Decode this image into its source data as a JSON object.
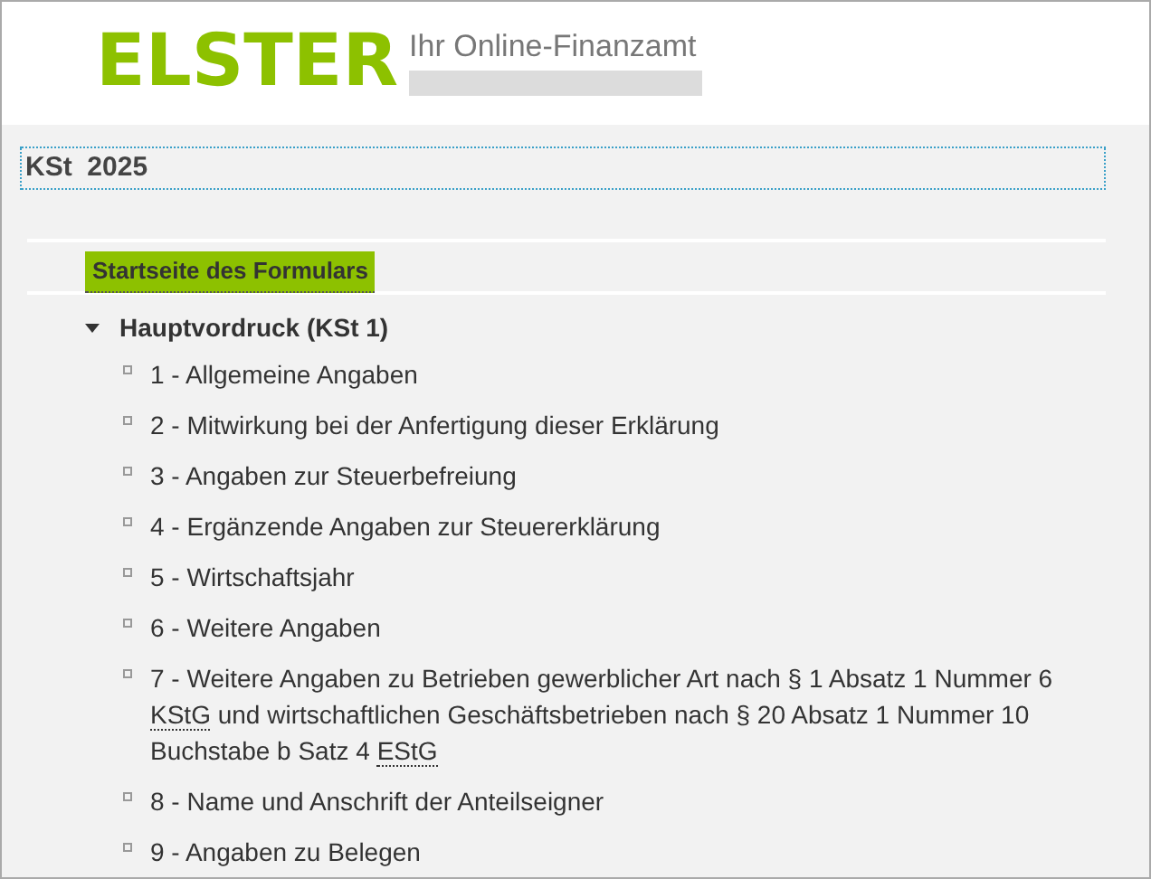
{
  "header": {
    "logo": "ELSTER",
    "subtitle": "Ihr Online-Finanzamt"
  },
  "form_title": "KSt  2025",
  "start_link": {
    "label": "Startseite des Formulars",
    "selected": true
  },
  "tree": {
    "label": "Hauptvordruck (KSt 1)",
    "expanded": true,
    "children": [
      {
        "segments": [
          {
            "kind": "plain",
            "text": "1 - Allgemeine Angaben"
          }
        ]
      },
      {
        "segments": [
          {
            "kind": "plain",
            "text": "2 - Mitwirkung bei der Anfertigung dieser Erklärung"
          }
        ]
      },
      {
        "segments": [
          {
            "kind": "plain",
            "text": "3 - Angaben zur Steuerbefreiung"
          }
        ]
      },
      {
        "segments": [
          {
            "kind": "plain",
            "text": "4 - Ergänzende Angaben zur Steuererklärung"
          }
        ]
      },
      {
        "segments": [
          {
            "kind": "plain",
            "text": "5 - Wirtschaftsjahr"
          }
        ]
      },
      {
        "segments": [
          {
            "kind": "plain",
            "text": "6 - Weitere Angaben"
          }
        ]
      },
      {
        "segments": [
          {
            "kind": "plain",
            "text": "7 - Weitere Angaben zu Betrieben gewerblicher Art nach § 1 Absatz 1 Nummer 6 "
          },
          {
            "kind": "abbr",
            "text": "KStG"
          },
          {
            "kind": "plain",
            "text": " und wirtschaftlichen Geschäftsbetrieben nach § 20 Absatz 1 Nummer 10 Buchstabe b Satz 4 "
          },
          {
            "kind": "abbr",
            "text": "EStG"
          }
        ]
      },
      {
        "segments": [
          {
            "kind": "plain",
            "text": "8 - Name und Anschrift der Anteilseigner"
          }
        ]
      },
      {
        "segments": [
          {
            "kind": "plain",
            "text": "9 - Angaben zu Belegen"
          }
        ]
      }
    ]
  }
}
